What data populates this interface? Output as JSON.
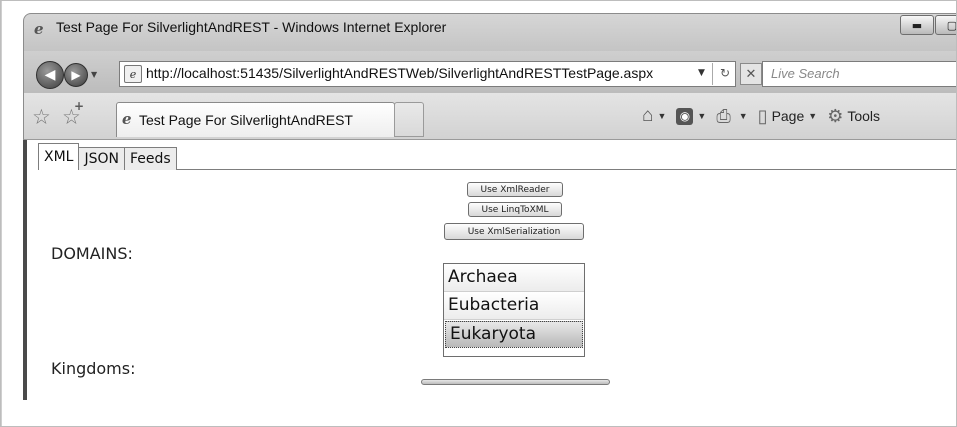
{
  "window": {
    "title": "Test Page For SilverlightAndREST - Windows Internet Explorer",
    "controls": {
      "minimize": "▬",
      "maximize": "▢"
    }
  },
  "nav": {
    "back": "◀",
    "forward": "▶",
    "url": "http://localhost:51435/SilverlightAndRESTWeb/SilverlightAndRESTTestPage.aspx",
    "refresh": "↻",
    "stop": "✕",
    "search_placeholder": "Live Search"
  },
  "tabbar": {
    "active_tab": "Test Page For SilverlightAndREST",
    "page_menu": "Page",
    "tools_menu": "Tools"
  },
  "content": {
    "tabs": [
      "XML",
      "JSON",
      "Feeds"
    ],
    "active_tab_index": 0,
    "buttons": {
      "xml_reader": "Use XmlReader",
      "linq_to_xml": "Use LinqToXML",
      "xml_serialization": "Use XmlSerialization"
    },
    "domains_label": "DOMAINS:",
    "domains": [
      "Archaea",
      "Eubacteria",
      "Eukaryota"
    ],
    "selected_domain": "Eukaryota",
    "kingdoms_label": "Kingdoms:"
  },
  "icons": {
    "ie_logo": "ie-logo-icon",
    "favorites": "star-icon",
    "add_favorites": "star-plus-icon",
    "home": "home-icon",
    "feeds": "rss-icon",
    "print": "printer-icon",
    "page": "page-icon",
    "tools": "gear-icon"
  }
}
